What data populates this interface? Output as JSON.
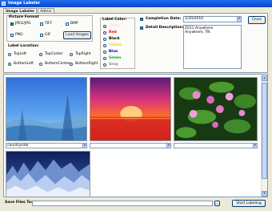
{
  "window": {
    "title": "Image Labeler"
  },
  "tabs": [
    {
      "label": "Image Labeler",
      "active": true
    },
    {
      "label": "Admin",
      "active": false
    }
  ],
  "picture_format": {
    "title": "Picture Format",
    "options": [
      {
        "label": "JPEG/JPG",
        "checked": true
      },
      {
        "label": "TIFF",
        "checked": false
      },
      {
        "label": "BMP",
        "checked": false
      },
      {
        "label": "PNG",
        "checked": false
      },
      {
        "label": "GIF",
        "checked": false
      }
    ],
    "load_button": "Load Images"
  },
  "label_location": {
    "title": "Label Location:",
    "options": [
      {
        "label": "TopLeft",
        "selected": false
      },
      {
        "label": "TopCenter",
        "selected": false
      },
      {
        "label": "TopRight",
        "selected": false
      },
      {
        "label": "BottomLeft",
        "selected": true
      },
      {
        "label": "BottomCenter",
        "selected": false
      },
      {
        "label": "BottomRight",
        "selected": false
      }
    ]
  },
  "label_color": {
    "title": "Label Color:",
    "options": [
      {
        "label": "White",
        "color": "#ffffff",
        "selected": true
      },
      {
        "label": "Red",
        "color": "#ff0000",
        "selected": false
      },
      {
        "label": "Black",
        "color": "#000000",
        "selected": false
      },
      {
        "label": "Yellow",
        "color": "#e6e600",
        "selected": false
      },
      {
        "label": "Blue",
        "color": "#0000ff",
        "selected": false
      },
      {
        "label": "Green",
        "color": "#00aa00",
        "selected": false
      },
      {
        "label": "Gray",
        "color": "#8a8a8a",
        "selected": false
      }
    ]
  },
  "completion": {
    "label": "Completion Date:",
    "checked": true,
    "value": "1/20/2010"
  },
  "detail": {
    "label": "Detail Description:",
    "checked": true,
    "lines": [
      "2011 Anywhere",
      "Anywhere, TN"
    ]
  },
  "close_button": "Close",
  "gallery": {
    "captions": [
      "countryside",
      "",
      ""
    ],
    "scroll_up_icon": "up-arrow-icon",
    "scroll_down_icon": "down-arrow-icon"
  },
  "footer": {
    "save_label": "Save Files To:",
    "save_value": "",
    "browse_label": "...",
    "start_button": "Start Labeling"
  }
}
